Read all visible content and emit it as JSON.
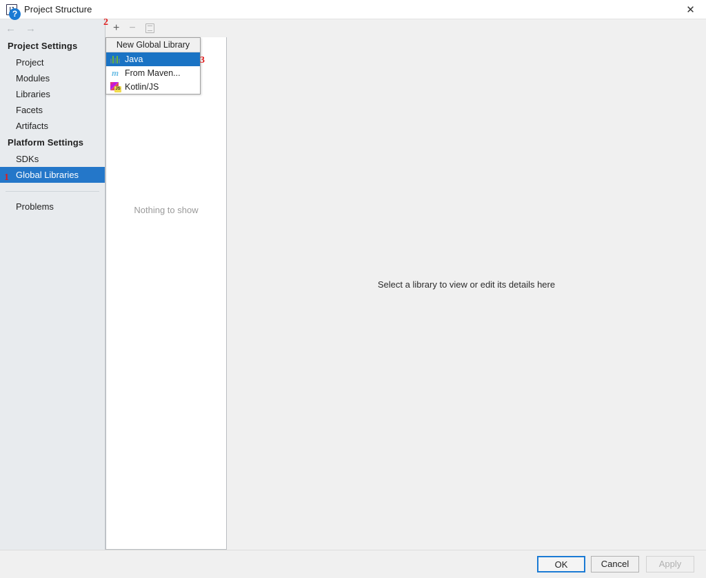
{
  "window": {
    "title": "Project Structure",
    "app_icon": "intellij-idea-icon",
    "close_label": "✕"
  },
  "nav": {
    "back_icon": "←",
    "forward_icon": "→"
  },
  "sidebar": {
    "sections": [
      {
        "header": "Project Settings",
        "items": [
          {
            "label": "Project",
            "selected": false
          },
          {
            "label": "Modules",
            "selected": false
          },
          {
            "label": "Libraries",
            "selected": false
          },
          {
            "label": "Facets",
            "selected": false
          },
          {
            "label": "Artifacts",
            "selected": false
          }
        ]
      },
      {
        "header": "Platform Settings",
        "items": [
          {
            "label": "SDKs",
            "selected": false
          },
          {
            "label": "Global Libraries",
            "selected": true
          }
        ]
      }
    ],
    "extra_items": [
      {
        "label": "Problems"
      }
    ]
  },
  "toolbar": {
    "add_label": "+",
    "remove_label": "−",
    "copy_label": "copy-icon"
  },
  "mid_panel": {
    "empty_text": "Nothing to show"
  },
  "detail_panel": {
    "hint_text": "Select a library to view or edit its details here"
  },
  "popup": {
    "title": "New Global Library",
    "items": [
      {
        "label": "Java",
        "icon": "java-icon",
        "highlighted": true
      },
      {
        "label": "From Maven...",
        "icon": "maven-icon",
        "highlighted": false
      },
      {
        "label": "Kotlin/JS",
        "icon": "kotlin-js-icon",
        "highlighted": false
      }
    ]
  },
  "annotations": [
    {
      "text": "1",
      "target": "global-libraries"
    },
    {
      "text": "2",
      "target": "add-button"
    },
    {
      "text": "3",
      "target": "java-menu-item"
    }
  ],
  "footer": {
    "help_label": "?",
    "ok_label": "OK",
    "cancel_label": "Cancel",
    "apply_label": "Apply"
  },
  "colors": {
    "accent": "#2477c9",
    "menu_highlight": "#1a73c4",
    "annotation": "#e01b1b",
    "sidebar_bg": "#e8ebee"
  }
}
